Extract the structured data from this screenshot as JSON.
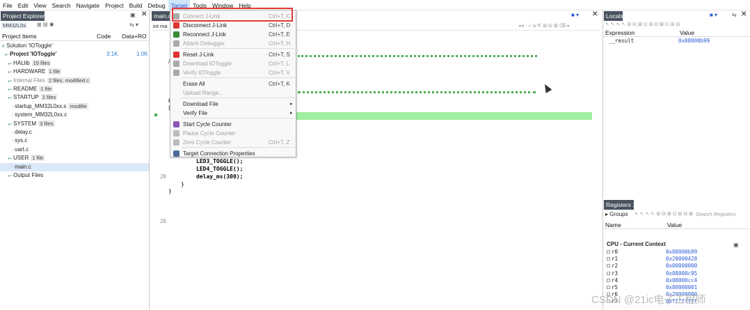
{
  "menubar": [
    "File",
    "Edit",
    "View",
    "Search",
    "Navigate",
    "Project",
    "Build",
    "Debug",
    "Target",
    "Tools",
    "Window",
    "Help"
  ],
  "project_explorer": {
    "title": "Project Explorer",
    "toolbar_label": "MM32L0x",
    "col_items": "Project Items",
    "col_code": "Code",
    "col_data": "Data+RO",
    "rows": [
      {
        "label": "Solution 'IOToggle'",
        "badge": "",
        "code": "",
        "data": "",
        "indent": 0
      },
      {
        "label": "Project 'IOToggle'",
        "badge": "",
        "code": "3.1K",
        "data": "1.0K",
        "indent": 1,
        "bold": true
      },
      {
        "label": "HALlib",
        "badge": "15 files",
        "code": "",
        "data": "",
        "indent": 2
      },
      {
        "label": "HARDWARE",
        "badge": "1 file",
        "code": "",
        "data": "",
        "indent": 2
      },
      {
        "label": "Internal Files",
        "badge": "2 files, modified c",
        "code": "",
        "data": "",
        "indent": 2,
        "muted": true
      },
      {
        "label": "README",
        "badge": "1 file",
        "code": "",
        "data": "",
        "indent": 2
      },
      {
        "label": "STARTUP",
        "badge": "2 files",
        "code": "",
        "data": "",
        "indent": 2
      },
      {
        "label": "startup_MM32L0xx.s",
        "badge": "modifie",
        "code": "",
        "data": "",
        "indent": 3
      },
      {
        "label": "system_MM32L0xx.c",
        "badge": "",
        "code": "",
        "data": "",
        "indent": 3
      },
      {
        "label": "SYSTEM",
        "badge": "3 files",
        "code": "",
        "data": "",
        "indent": 2
      },
      {
        "label": "delay.c",
        "badge": "",
        "code": "",
        "data": "",
        "indent": 3
      },
      {
        "label": "sys.c",
        "badge": "",
        "code": "",
        "data": "",
        "indent": 3
      },
      {
        "label": "uart.c",
        "badge": "",
        "code": "",
        "data": "",
        "indent": 3
      },
      {
        "label": "USER",
        "badge": "1 file",
        "code": "",
        "data": "",
        "indent": 2
      },
      {
        "label": "main.c",
        "badge": "",
        "code": "",
        "data": "",
        "indent": 3,
        "selected": true
      },
      {
        "label": "Output Files",
        "badge": "",
        "code": "",
        "data": "",
        "indent": 2
      }
    ]
  },
  "editor": {
    "tab": "main.c",
    "scope": "int ma",
    "lines": [
      {
        "num": "",
        "text": "LED3_TOGGLE();"
      },
      {
        "num": "",
        "text": "LED4_TOGGLE();"
      },
      {
        "num": "20",
        "text": "delay_ms(300);"
      },
      {
        "num": "",
        "text": "}"
      },
      {
        "num": "",
        "text": "}"
      },
      {
        "num": "26",
        "text": ""
      }
    ],
    "delay_arg": "300"
  },
  "target_menu": {
    "items": [
      {
        "label": "Connect J-Link",
        "shortcut": "Ctrl+T, C",
        "disabled": true,
        "icon": "connect-icon"
      },
      {
        "label": "Disconnect J-Link",
        "shortcut": "Ctrl+T, D",
        "disabled": false,
        "icon": "disconnect-icon"
      },
      {
        "label": "Reconnect J-Link",
        "shortcut": "Ctrl+T, E",
        "disabled": false,
        "icon": "reconnect-icon"
      },
      {
        "label": "Attach Debugger",
        "shortcut": "Ctrl+T, H",
        "disabled": true,
        "icon": "attach-icon"
      },
      {
        "label": "Reset J-Link",
        "shortcut": "Ctrl+T, S",
        "disabled": false,
        "icon": "reset-icon"
      },
      {
        "label": "Download IOToggle",
        "shortcut": "Ctrl+T, L",
        "disabled": true,
        "icon": "download-icon"
      },
      {
        "label": "Verify IOToggle",
        "shortcut": "Ctrl+T, V",
        "disabled": true,
        "icon": "verify-icon"
      },
      {
        "label": "Erase All",
        "shortcut": "Ctrl+T, K",
        "disabled": false,
        "icon": ""
      },
      {
        "label": "Upload Range...",
        "shortcut": "",
        "disabled": true,
        "icon": ""
      },
      {
        "label": "Download File",
        "shortcut": "",
        "disabled": false,
        "icon": "",
        "submenu": true
      },
      {
        "label": "Verify File",
        "shortcut": "",
        "disabled": false,
        "icon": "",
        "submenu": true
      },
      {
        "label": "Start Cycle Counter",
        "shortcut": "",
        "disabled": false,
        "icon": "start-counter-icon"
      },
      {
        "label": "Pause Cycle Counter",
        "shortcut": "",
        "disabled": true,
        "icon": "pause-counter-icon"
      },
      {
        "label": "Zero Cycle Counter",
        "shortcut": "Ctrl+T, Z",
        "disabled": true,
        "icon": "zero-counter-icon"
      },
      {
        "label": "Target Connection Properties",
        "shortcut": "",
        "disabled": false,
        "icon": "properties-icon"
      }
    ]
  },
  "locals": {
    "title": "Locals",
    "col_expr": "Expression",
    "col_value": "Value",
    "rows": [
      {
        "expr": "__result",
        "value": "0x08000b99"
      }
    ]
  },
  "registers": {
    "title": "Registers 1",
    "groups": "Groups",
    "search_placeholder": "Search Registers",
    "col_name": "Name",
    "col_value": "Value",
    "group_label": "CPU - Current Context",
    "rows": [
      {
        "name": "r0",
        "value": "0x08000b99"
      },
      {
        "name": "r1",
        "value": "0x20000428"
      },
      {
        "name": "r2",
        "value": "0x00000000"
      },
      {
        "name": "r3",
        "value": "0x08000c95"
      },
      {
        "name": "r4",
        "value": "0x08000cc4"
      },
      {
        "name": "r5",
        "value": "0x00000001"
      },
      {
        "name": "r6",
        "value": "0x20000000"
      },
      {
        "name": "r7",
        "value": "0xffffffff"
      }
    ]
  },
  "watermark": "CSDN @21ic电子工程师",
  "colors": {
    "accent": "#2a5bd7",
    "highlight": "#9ff09f",
    "redbox": "#e53935"
  }
}
